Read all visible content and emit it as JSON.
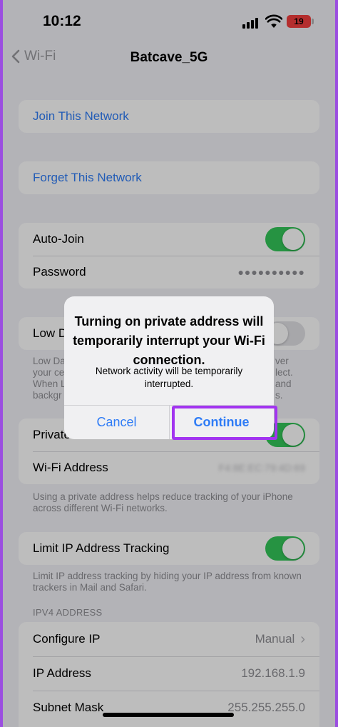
{
  "status": {
    "time": "10:12",
    "battery": "19"
  },
  "nav": {
    "back_label": "Wi-Fi",
    "title": "Batcave_5G"
  },
  "actions": {
    "join": "Join This Network",
    "forget": "Forget This Network"
  },
  "settings": {
    "auto_join": "Auto-Join",
    "password": "Password",
    "password_mask": "●●●●●●●●●●",
    "low_data_partial": "Low D",
    "low_data_footnote_left": [
      "Low Da",
      "your ce",
      "When L",
      "backgr"
    ],
    "low_data_footnote_right": [
      "ver",
      "lect.",
      "and",
      "s."
    ],
    "private_partial": "Private",
    "wifi_address": "Wi-Fi Address",
    "wifi_address_value": "F4:8E:EC:79:4D:69",
    "private_footnote": "Using a private address helps reduce tracking of your iPhone across different Wi-Fi networks.",
    "limit_ip": "Limit IP Address Tracking",
    "limit_ip_footnote": "Limit IP address tracking by hiding your IP address from known trackers in Mail and Safari."
  },
  "ipv4": {
    "header": "IPV4 ADDRESS",
    "configure_ip": "Configure IP",
    "configure_ip_value": "Manual",
    "ip_address": "IP Address",
    "ip_address_value": "192.168.1.9",
    "subnet_mask": "Subnet Mask",
    "subnet_mask_value": "255.255.255.0"
  },
  "alert": {
    "title": "Turning on private address will temporarily interrupt your Wi-Fi connection.",
    "message": "Network activity will be temporarily interrupted.",
    "cancel": "Cancel",
    "continue": "Continue"
  },
  "colors": {
    "accent": "#2f7cf6",
    "toggle_on": "#34c759",
    "highlight": "#a234f0",
    "background": "#f2f2f7"
  },
  "toggles": {
    "auto_join": true,
    "low_data_mode": false,
    "private_address": true,
    "limit_ip_tracking": true
  }
}
